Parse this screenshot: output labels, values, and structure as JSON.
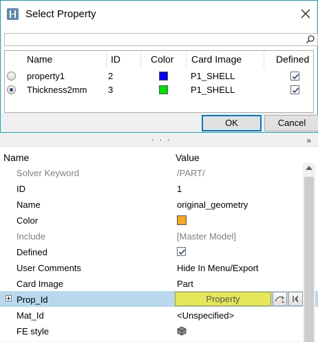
{
  "dialog": {
    "title": "Select Property",
    "search": {
      "value": "",
      "placeholder": ""
    },
    "columns": [
      "Name",
      "ID",
      "Color",
      "Card Image",
      "Defined"
    ],
    "rows": [
      {
        "name": "property1",
        "id": "2",
        "color": "#0000ff",
        "card_image": "P1_SHELL",
        "defined": true,
        "selected": false
      },
      {
        "name": "Thickness2mm",
        "id": "3",
        "color": "#00e000",
        "card_image": "P1_SHELL",
        "defined": true,
        "selected": true
      }
    ],
    "ok_label": "OK",
    "cancel_label": "Cancel"
  },
  "splitter": {
    "grip": "· · ·",
    "collapse": "»"
  },
  "editor": {
    "header": {
      "name": "Name",
      "value": "Value"
    },
    "rows": [
      {
        "key": "Solver Keyword",
        "value": "/PART/",
        "muted": true
      },
      {
        "key": "ID",
        "value": "1"
      },
      {
        "key": "Name",
        "value": "original_geometry"
      },
      {
        "key": "Color",
        "value": "",
        "swatch": "#f5a623"
      },
      {
        "key": "Include",
        "value": "[Master Model]",
        "muted": true
      },
      {
        "key": "Defined",
        "value": "",
        "checked": true
      },
      {
        "key": "User Comments",
        "value": "Hide In Menu/Export"
      },
      {
        "key": "Card Image",
        "value": "Part"
      },
      {
        "key": "Prop_Id",
        "value": "Property",
        "selected": true
      },
      {
        "key": "Mat_Id",
        "value": "<Unspecified>"
      },
      {
        "key": "FE style",
        "value": "",
        "icon": "shaded-cube-icon"
      }
    ]
  },
  "colors": {
    "accent": "#0078d7",
    "dialog_border": "#1ba1c6",
    "selection": "#b8d8ee",
    "property_button": "#e5e759"
  }
}
